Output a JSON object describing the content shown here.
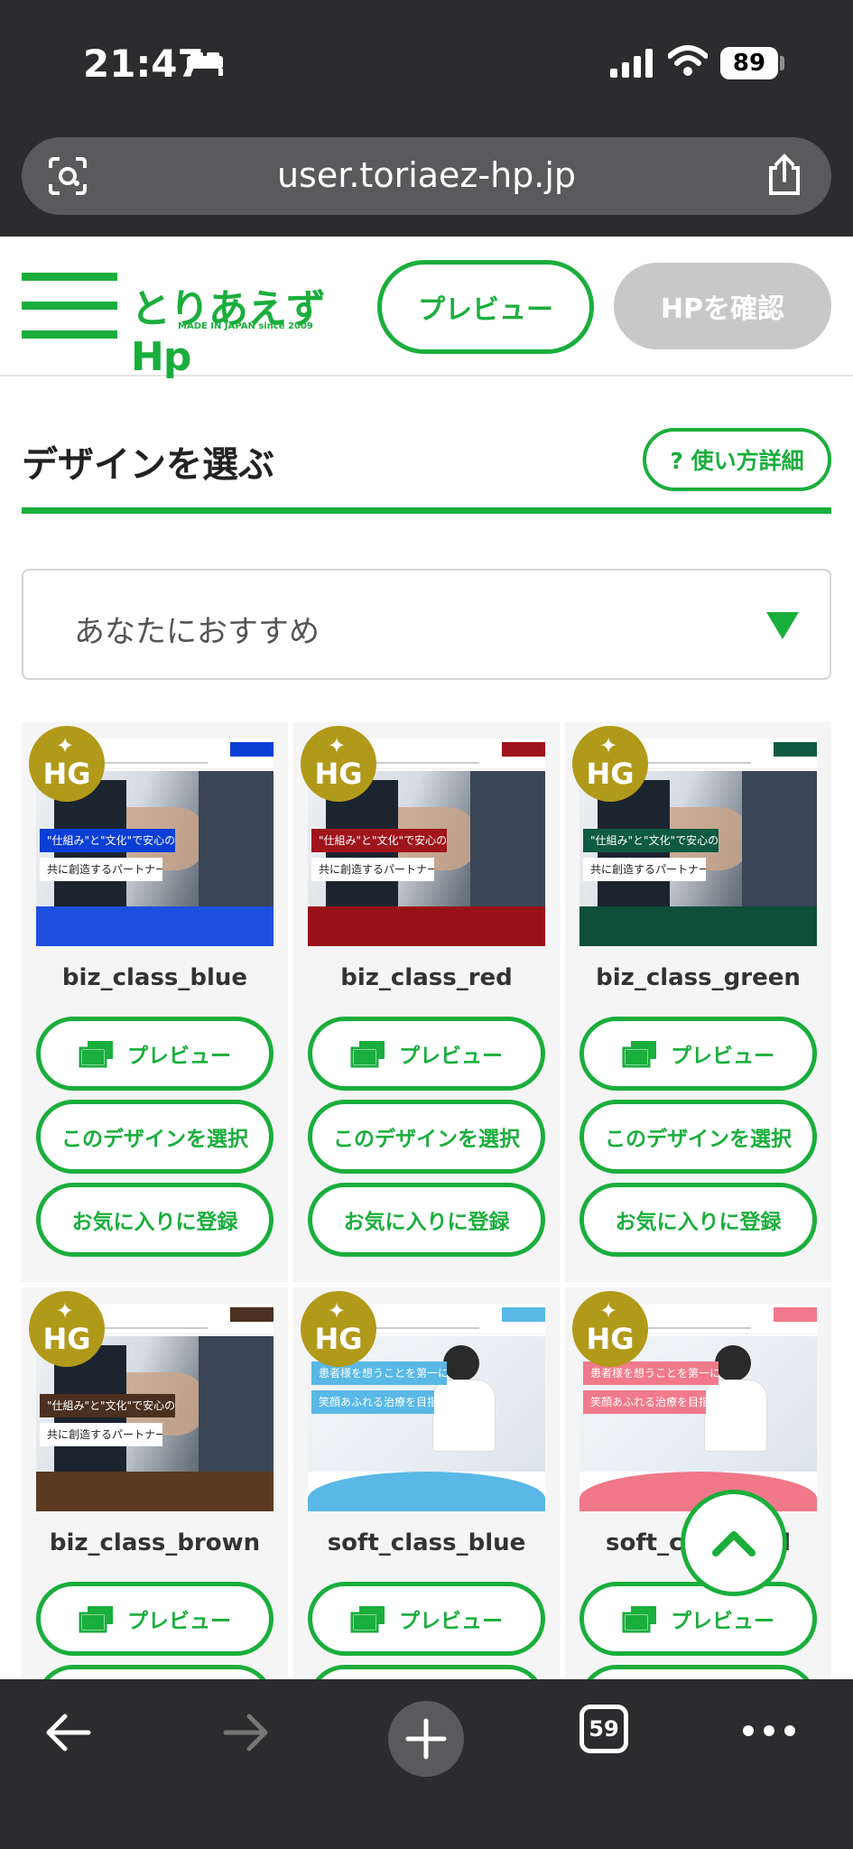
{
  "status_bar": {
    "time": "21:47",
    "battery": "89"
  },
  "browser": {
    "url": "user.toriaez-hp.jp",
    "tab_count": "59"
  },
  "header": {
    "logo_text": "とりあえずHp",
    "logo_sub": "MADE IN JAPAN since 2009",
    "preview_label": "プレビュー",
    "confirm_label": "HPを確認"
  },
  "section": {
    "title": "デザインを選ぶ",
    "help_label": "? 使い方詳細"
  },
  "filter": {
    "selected": "あなたにおすすめ"
  },
  "card_labels": {
    "preview": "プレビュー",
    "select": "このデザインを選択",
    "favorite": "お気に入りに登録",
    "badge": "HG"
  },
  "designs": [
    {
      "name": "biz_class_blue",
      "accent": "#0a3fd6",
      "band": "#1e4fe0"
    },
    {
      "name": "biz_class_red",
      "accent": "#a0141c",
      "band": "#9a1018"
    },
    {
      "name": "biz_class_green",
      "accent": "#0f5a42",
      "band": "#0e4f3a"
    },
    {
      "name": "biz_class_brown",
      "accent": "#4b3020",
      "band": "#5a3a22"
    },
    {
      "name": "soft_class_blue",
      "accent": "#59b8e6",
      "band": "#5ab8e6"
    },
    {
      "name": "soft_class_red",
      "accent": "#f07a8c",
      "band": "#f07888"
    }
  ],
  "thumb_text": {
    "biz_line1": "\"仕組み\"と\"文化\"で安心の橋を",
    "biz_line2": "共に創造するパートナー",
    "soft_line1": "患者様を想うことを第一に",
    "soft_line2": "笑顔あふれる治療を目指しています"
  },
  "colors": {
    "brand_green": "#1aae3c",
    "badge_gold": "#b19a1a"
  }
}
